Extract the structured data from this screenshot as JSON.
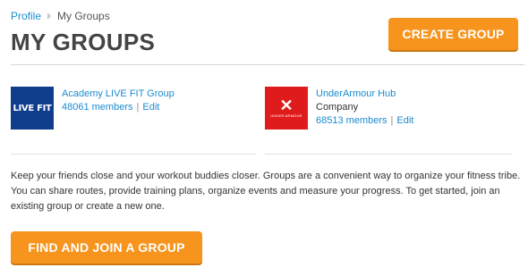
{
  "breadcrumb": {
    "profile": "Profile",
    "current": "My Groups"
  },
  "page_title": "MY GROUPS",
  "buttons": {
    "create": "CREATE GROUP",
    "find": "FIND AND JOIN A GROUP"
  },
  "groups": [
    {
      "logo_text": "LIVE FIT",
      "name": "Academy LIVE FIT Group",
      "subtitle": "",
      "members": "48061 members",
      "edit": "Edit"
    },
    {
      "logo_text": "UNDER ARMOUR",
      "name": "UnderArmour Hub",
      "subtitle": "Company",
      "members": "68513 members",
      "edit": "Edit"
    }
  ],
  "description": "Keep your friends close and your workout buddies closer. Groups are a convenient way to organize your fitness tribe. You can share routes, provide training plans, organize events and measure your progress. To get started, join an existing group or create a new one.",
  "colors": {
    "accent_orange": "#f7941d",
    "link_blue": "#1a8ccf",
    "livefit_blue": "#0f3d8c",
    "underarmour_red": "#e01b1b"
  }
}
